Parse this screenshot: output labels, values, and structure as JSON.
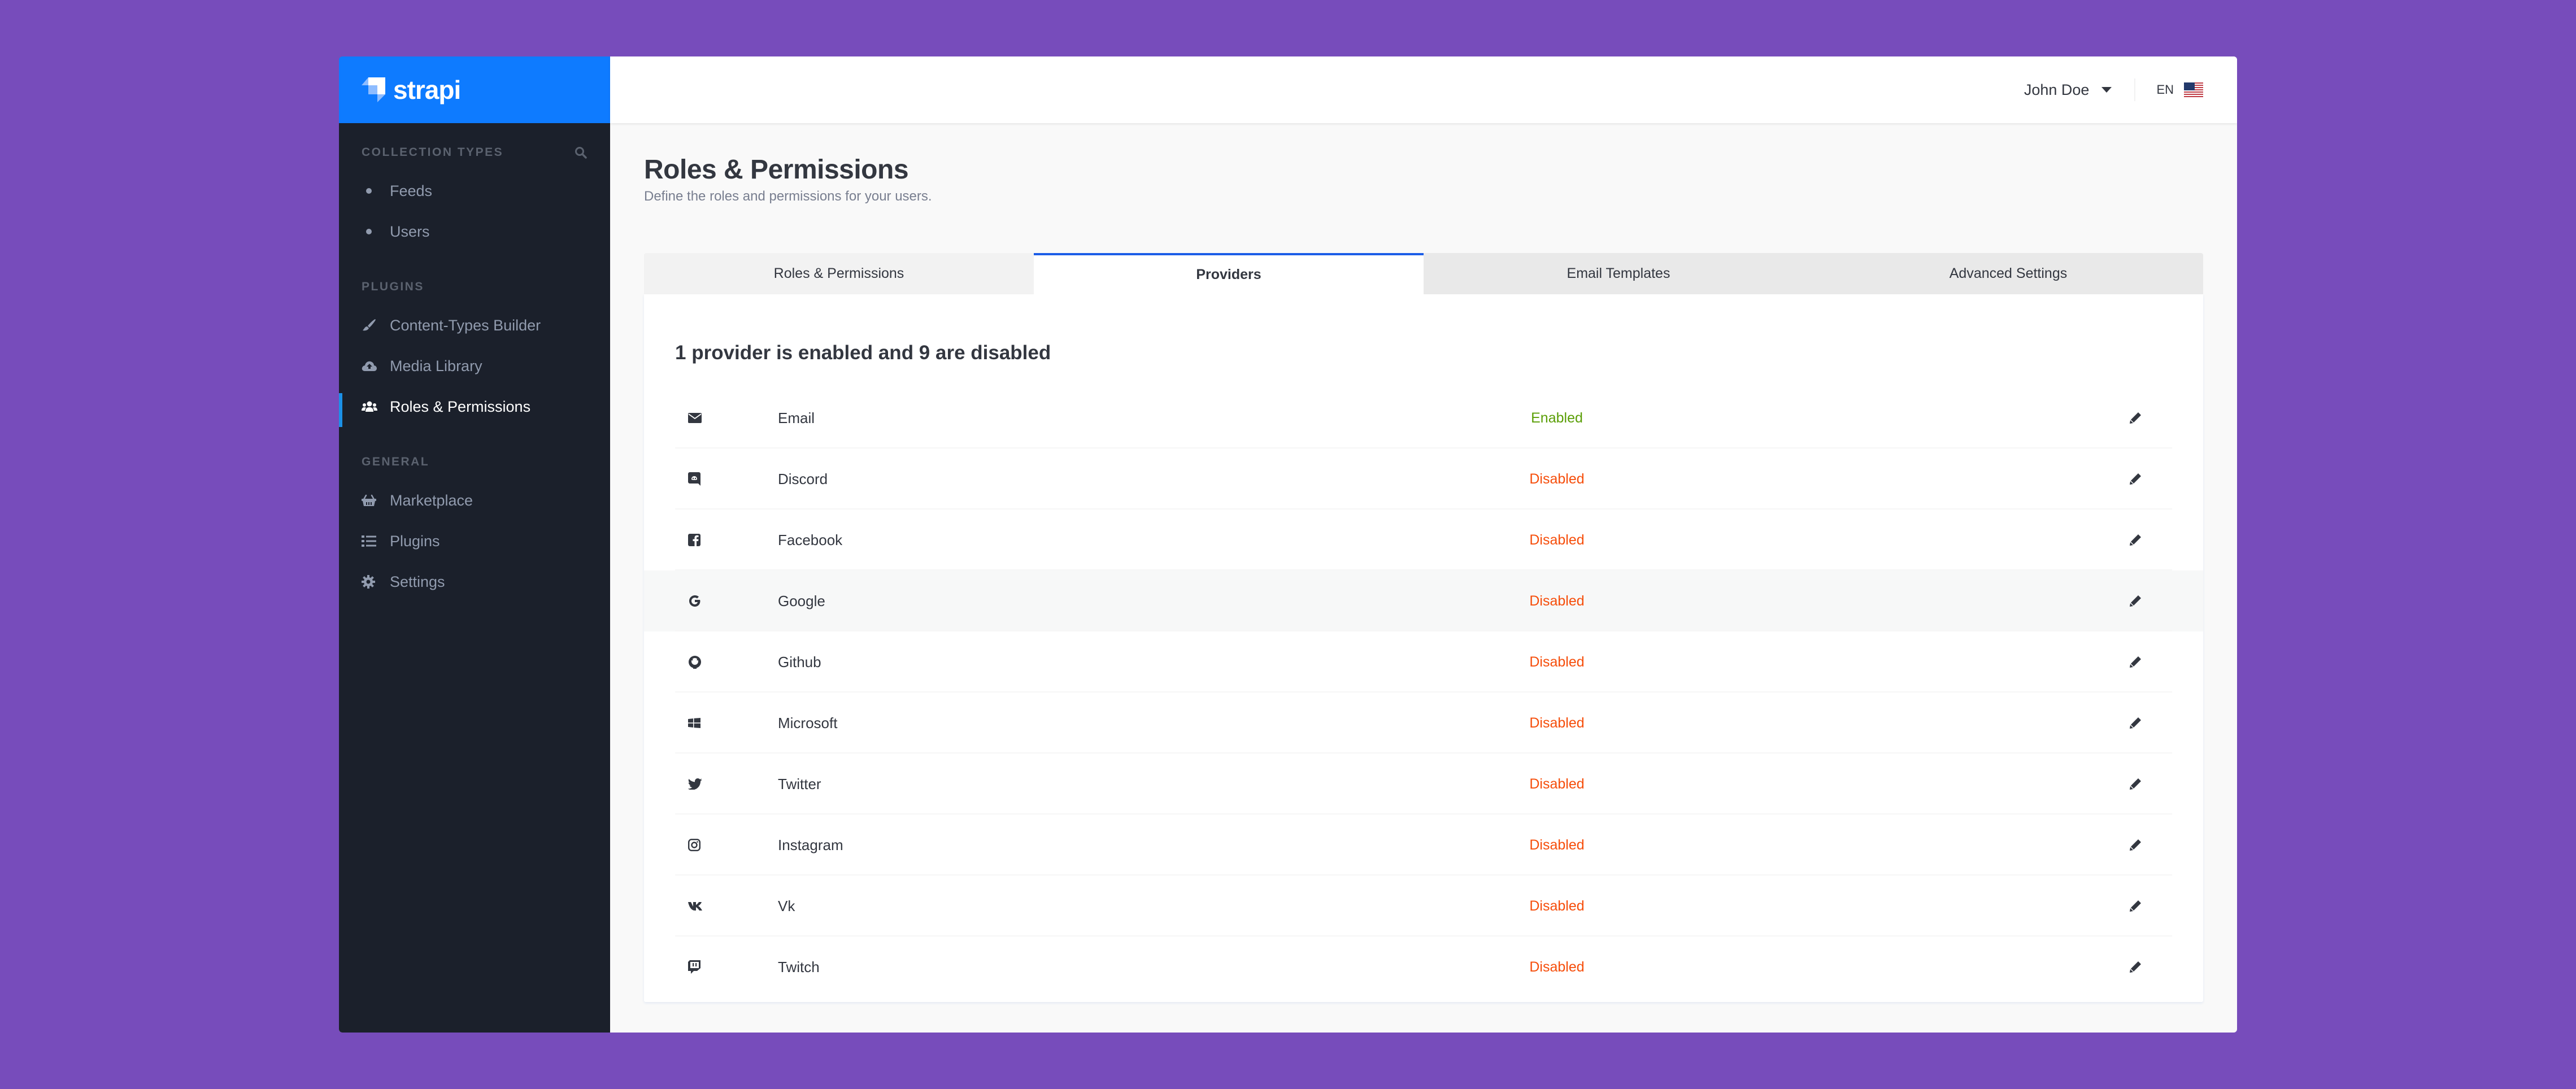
{
  "brand": {
    "name": "strapi",
    "color": "#0e7bff"
  },
  "sidebar": {
    "sections": [
      {
        "title": "Collection Types",
        "has_search": true,
        "items": [
          {
            "label": "Feeds",
            "icon": "bullet-icon",
            "active": false
          },
          {
            "label": "Users",
            "icon": "bullet-icon",
            "active": false
          }
        ]
      },
      {
        "title": "Plugins",
        "items": [
          {
            "label": "Content-Types Builder",
            "icon": "paint-brush-icon",
            "active": false
          },
          {
            "label": "Media Library",
            "icon": "cloud-upload-icon",
            "active": false
          },
          {
            "label": "Roles & Permissions",
            "icon": "users-icon",
            "active": true
          }
        ]
      },
      {
        "title": "General",
        "items": [
          {
            "label": "Marketplace",
            "icon": "shopping-basket-icon",
            "active": false
          },
          {
            "label": "Plugins",
            "icon": "list-icon",
            "active": false
          },
          {
            "label": "Settings",
            "icon": "gear-icon",
            "active": false
          }
        ]
      }
    ]
  },
  "header": {
    "user_name": "John Doe",
    "language": "EN",
    "flag": "us-flag-icon"
  },
  "page": {
    "title": "Roles & Permissions",
    "subtitle": "Define the roles and permissions for your users."
  },
  "tabs": [
    {
      "label": "Roles & Permissions",
      "active": false
    },
    {
      "label": "Providers",
      "active": true
    },
    {
      "label": "Email Templates",
      "active": false
    },
    {
      "label": "Advanced Settings",
      "active": false
    }
  ],
  "providers": {
    "summary": "1 provider is enabled and 9 are disabled",
    "status_colors": {
      "enabled": "#5a9e06",
      "disabled": "#f64d0a"
    },
    "rows": [
      {
        "name": "Email",
        "icon": "envelope-icon",
        "status": "Enabled"
      },
      {
        "name": "Discord",
        "icon": "discord-icon",
        "status": "Disabled"
      },
      {
        "name": "Facebook",
        "icon": "facebook-icon",
        "status": "Disabled"
      },
      {
        "name": "Google",
        "icon": "google-icon",
        "status": "Disabled"
      },
      {
        "name": "Github",
        "icon": "github-icon",
        "status": "Disabled"
      },
      {
        "name": "Microsoft",
        "icon": "windows-icon",
        "status": "Disabled"
      },
      {
        "name": "Twitter",
        "icon": "twitter-icon",
        "status": "Disabled"
      },
      {
        "name": "Instagram",
        "icon": "instagram-icon",
        "status": "Disabled"
      },
      {
        "name": "Vk",
        "icon": "vk-icon",
        "status": "Disabled"
      },
      {
        "name": "Twitch",
        "icon": "twitch-icon",
        "status": "Disabled"
      }
    ]
  }
}
